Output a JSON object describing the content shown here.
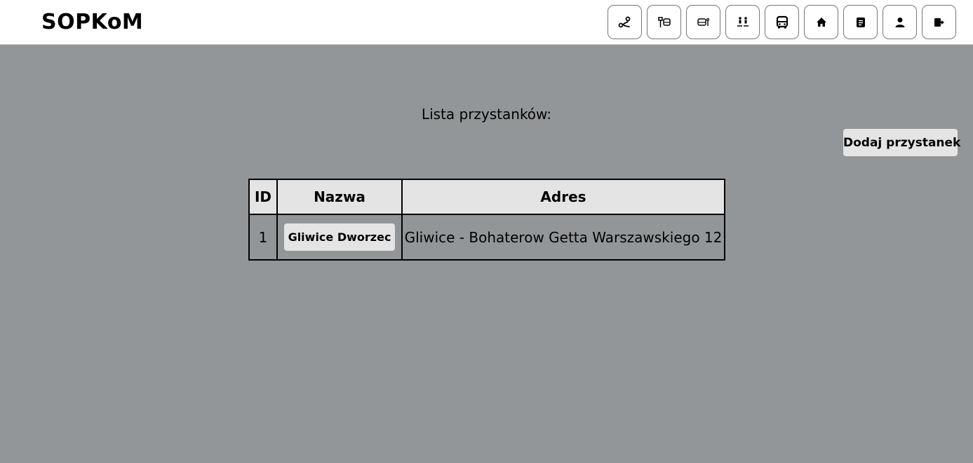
{
  "app": {
    "logo": "SOPKoM"
  },
  "nav": {
    "items": [
      {
        "icon": "route-icon"
      },
      {
        "icon": "bus-stop-icon"
      },
      {
        "icon": "bus-station-icon"
      },
      {
        "icon": "passengers-icon"
      },
      {
        "icon": "bus-icon"
      },
      {
        "icon": "home-icon"
      },
      {
        "icon": "document-icon"
      },
      {
        "icon": "user-icon"
      },
      {
        "icon": "logout-icon"
      }
    ]
  },
  "main": {
    "title": "Lista przystanków:",
    "add_button": "Dodaj przystanek"
  },
  "table": {
    "headers": {
      "id": "ID",
      "name": "Nazwa",
      "address": "Adres"
    },
    "rows": [
      {
        "id": "1",
        "name": "Gliwice Dworzec",
        "address": "Gliwice - Bohaterow Getta Warszawskiego 12"
      }
    ]
  }
}
